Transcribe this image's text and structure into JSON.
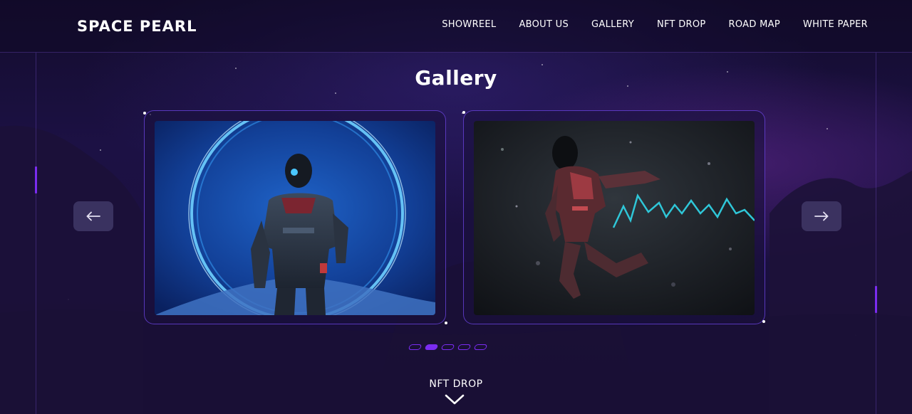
{
  "header": {
    "logo": "SPACE PEARL",
    "nav": [
      "SHOWREEL",
      "ABOUT US",
      "GALLERY",
      "NFT DROP",
      "ROAD MAP",
      "WHITE PAPER"
    ]
  },
  "gallery": {
    "title": "Gallery",
    "prev_icon": "arrow-left-icon",
    "next_icon": "arrow-right-icon",
    "slides_total": 5,
    "active_slide": 2
  },
  "footer_link": {
    "label": "NFT DROP",
    "icon": "chevron-down-icon"
  },
  "colors": {
    "accent": "#7a2cf0",
    "background": "#170e33"
  }
}
